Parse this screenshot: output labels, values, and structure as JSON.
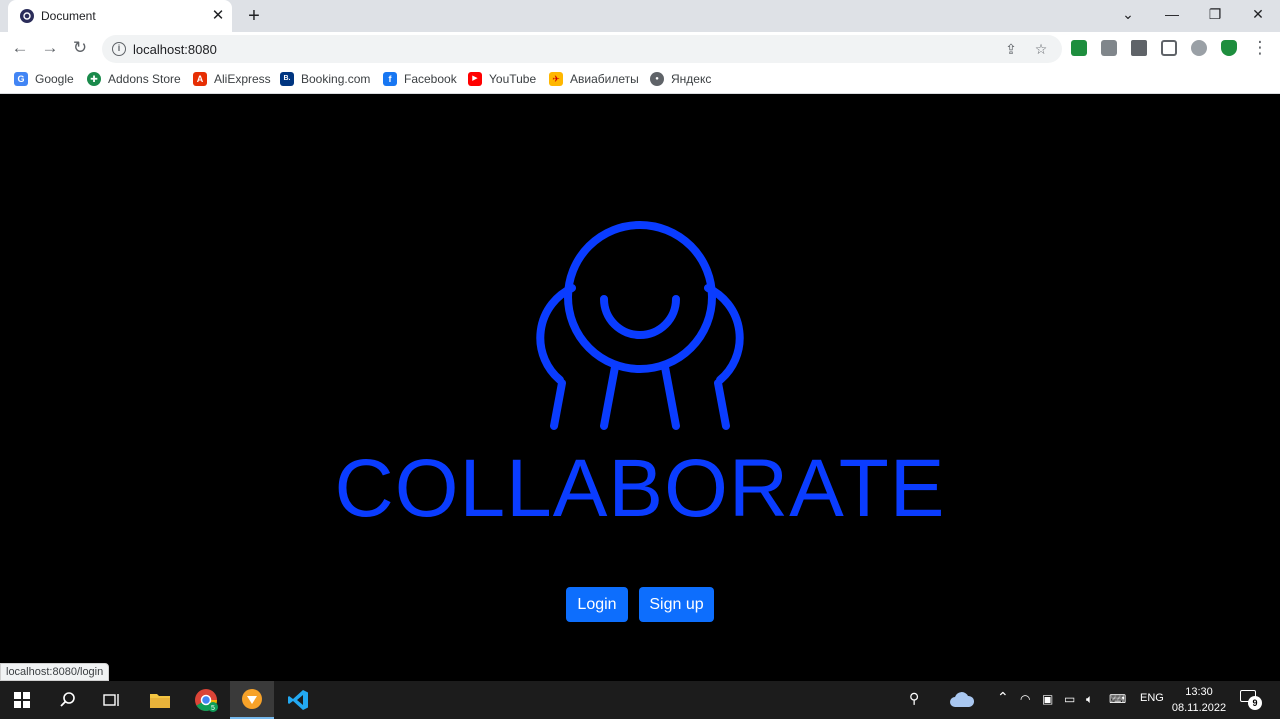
{
  "browser": {
    "tab_title": "Document",
    "new_tab_symbol": "+",
    "address": "localhost:8080",
    "bookmarks": [
      {
        "label": "Google",
        "icon": "google-icon",
        "color": "#4285f4",
        "glyph": "G"
      },
      {
        "label": "Addons Store",
        "icon": "addons-store-icon",
        "color": "#1a8a4b",
        "glyph": "✚"
      },
      {
        "label": "AliExpress",
        "icon": "aliexpress-icon",
        "color": "#e62e04",
        "glyph": "A"
      },
      {
        "label": "Booking.com",
        "icon": "booking-icon",
        "color": "#003580",
        "glyph": "B."
      },
      {
        "label": "Facebook",
        "icon": "facebook-icon",
        "color": "#1877f2",
        "glyph": "f"
      },
      {
        "label": "YouTube",
        "icon": "youtube-icon",
        "color": "#ff0000",
        "glyph": "▶"
      },
      {
        "label": "Авиабилеты",
        "icon": "aviabilety-icon",
        "color": "#ffb700",
        "glyph": "✈"
      },
      {
        "label": "Яндекс",
        "icon": "yandex-icon",
        "color": "#5f6368",
        "glyph": "●"
      }
    ],
    "status_url": "localhost:8080/login"
  },
  "page": {
    "brand": "COLLABORATE",
    "login_label": "Login",
    "signup_label": "Sign up",
    "accent_color": "#0a3cff",
    "button_color": "#0d6efd"
  },
  "taskbar": {
    "language": "ENG",
    "time": "13:30",
    "date": "08.11.2022",
    "notifications": "9",
    "chrome_badge": "5"
  }
}
